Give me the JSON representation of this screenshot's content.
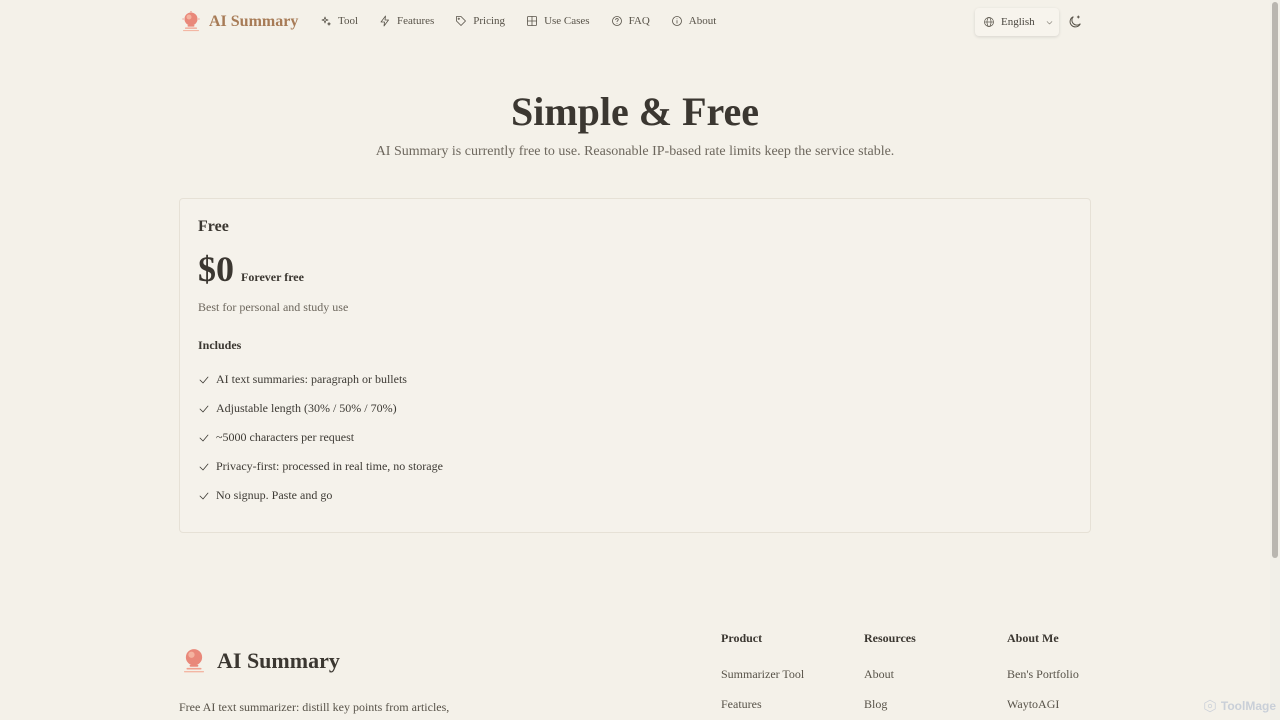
{
  "brand": {
    "name": "AI Summary",
    "logo_icon": "lightbulb-logo-icon"
  },
  "nav": [
    {
      "label": "Tool",
      "icon": "sparkles-icon"
    },
    {
      "label": "Features",
      "icon": "bolt-icon"
    },
    {
      "label": "Pricing",
      "icon": "tag-icon"
    },
    {
      "label": "Use Cases",
      "icon": "grid-icon"
    },
    {
      "label": "FAQ",
      "icon": "help-circle-icon"
    },
    {
      "label": "About",
      "icon": "info-icon"
    }
  ],
  "language": {
    "selected": "English",
    "icon": "globe-icon"
  },
  "theme_toggle": {
    "icon": "moon-icon"
  },
  "hero": {
    "title": "Simple & Free",
    "subtitle": "AI Summary is currently free to use. Reasonable IP-based rate limits keep the service stable."
  },
  "plan": {
    "name": "Free",
    "price": "$0",
    "price_note": "Forever free",
    "description": "Best for personal and study use",
    "includes_label": "Includes",
    "features": [
      "AI text summaries: paragraph or bullets",
      "Adjustable length (30% / 50% / 70%)",
      "~5000 characters per request",
      "Privacy-first: processed in real time, no storage",
      "No signup. Paste and go"
    ]
  },
  "footer": {
    "brand": "AI Summary",
    "description": "Free AI text summarizer: distill key points from articles,",
    "columns": [
      {
        "title": "Product",
        "links": [
          "Summarizer Tool",
          "Features"
        ]
      },
      {
        "title": "Resources",
        "links": [
          "About",
          "Blog"
        ]
      },
      {
        "title": "About Me",
        "links": [
          "Ben's Portfolio",
          "WaytoAGI"
        ]
      }
    ]
  },
  "watermark": "ToolMage",
  "colors": {
    "background": "#f4f1e9",
    "brand": "#a77b56",
    "text": "#3b3731"
  }
}
